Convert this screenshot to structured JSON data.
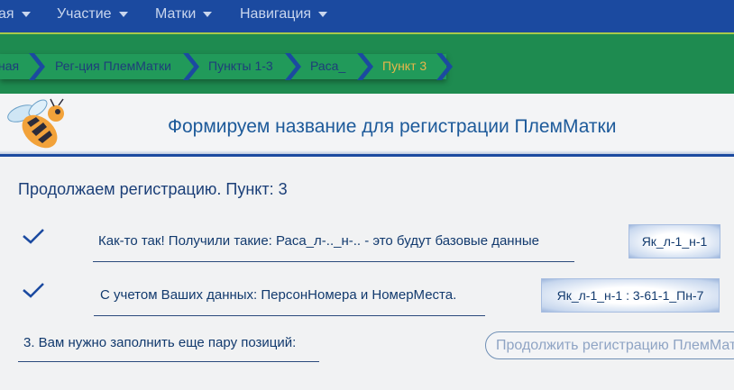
{
  "nav": {
    "items": [
      {
        "label": "ая"
      },
      {
        "label": "Участие"
      },
      {
        "label": "Матки"
      },
      {
        "label": "Навигация"
      }
    ]
  },
  "breadcrumbs": [
    {
      "label": "ная"
    },
    {
      "label": "Рег-ция ПлемМатки"
    },
    {
      "label": "Пункты 1-3"
    },
    {
      "label": "Раса_"
    },
    {
      "label": "Пункт 3"
    }
  ],
  "header": {
    "title": "Формируем название для регистрации ПлемМатки"
  },
  "main": {
    "subtitle": "Продолжаем регистрацию. Пункт: 3",
    "rows": [
      {
        "text": "Как-то так! Получили такие: Раса_л-.._н-.. - это будут базовые данные",
        "tag": "Як_л-1_н-1"
      },
      {
        "text": "С учетом Ваших данных: ПерсонНомера и НомерМеста.",
        "tag": "Як_л-1_н-1 : 3-61-1_Пн-7"
      },
      {
        "text": "3. Вам нужно заполнить еще пару позиций:"
      }
    ],
    "continue_label": "Продолжить регистрацию ПлемМатки"
  },
  "colors": {
    "nav_bg": "#1b4aa0",
    "band_green": "#1e8b50",
    "active_crumb": "#e8b64a",
    "text_blue": "#1d5a9a"
  },
  "icons": {
    "logo": "bee-icon",
    "check": "checkmark-icon",
    "separator": "chevron-right-icon",
    "dropdown": "caret-down-icon"
  }
}
